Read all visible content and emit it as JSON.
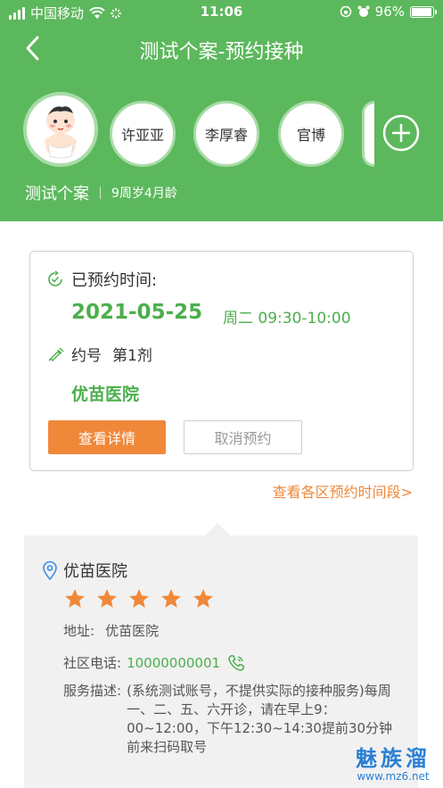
{
  "status_bar": {
    "carrier": "中国移动",
    "time": "11:06",
    "battery": "96%",
    "battery_level": 0.96
  },
  "nav": {
    "title": "测试个案-预约接种",
    "back_icon": "chevron-left-icon"
  },
  "children": {
    "selected_avatar_icon": "baby-avatar-icon",
    "names": [
      "许亚亚",
      "李厚睿",
      "官博"
    ],
    "add_icon": "plus-circle-icon"
  },
  "profile": {
    "name": "测试个案",
    "age": "9周岁4月龄"
  },
  "appointment": {
    "label": "已预约时间:",
    "date": "2021-05-25",
    "weekday_time": "周二 09:30-10:00",
    "dose_label": "约号",
    "dose_value": "第1剂",
    "hospital": "优苗医院",
    "detail_button": "查看详情",
    "cancel_button": "取消预约"
  },
  "view_periods_link": "查看各区预约时间段>",
  "hospital_info": {
    "name": "优苗医院",
    "rating": 5,
    "address_label": "地址:",
    "address": "优苗医院",
    "phone_label": "社区电话:",
    "phone": "10000000001",
    "desc_label": "服务描述:",
    "desc": "(系统测试账号，不提供实际的接种服务)每周一、二、五、六开诊，请在早上9：00~12:00，下午12:30~14:30提前30分钟前来扫码取号"
  },
  "watermark": {
    "main": "魅族溜",
    "sub": "www.mz6.net"
  },
  "colors": {
    "header_green": "#5cb85c",
    "accent_green": "#4cae4c",
    "orange": "#f0883a",
    "star": "#f0883a"
  }
}
